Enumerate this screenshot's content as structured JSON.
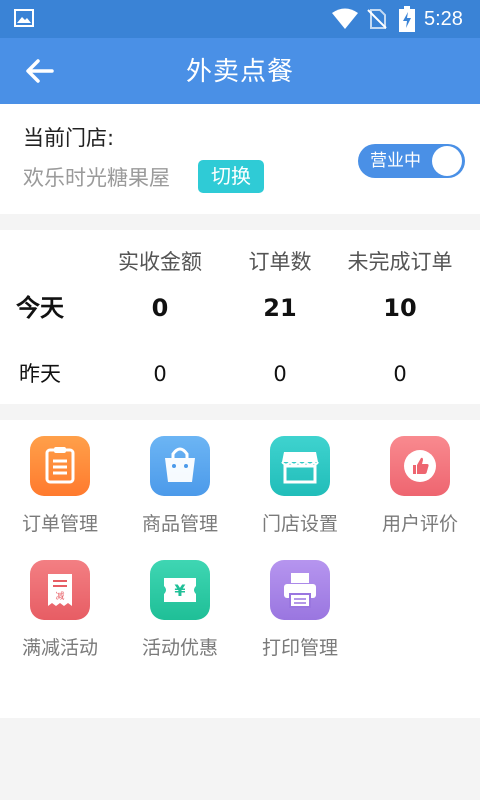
{
  "status_bar": {
    "time": "5:28"
  },
  "app_bar": {
    "title": "外卖点餐"
  },
  "store": {
    "label": "当前门店:",
    "name": "欢乐时光糖果屋",
    "switch_label": "切换",
    "status_toggle_label": "营业中"
  },
  "stats": {
    "headers": [
      "实收金额",
      "订单数",
      "未完成订单"
    ],
    "rows": [
      {
        "label": "今天",
        "values": [
          "0",
          "21",
          "10"
        ]
      },
      {
        "label": "昨天",
        "values": [
          "0",
          "0",
          "0"
        ]
      }
    ]
  },
  "menu": {
    "items": [
      {
        "label": "订单管理",
        "icon": "clipboard-icon",
        "color": "#ff8a3d"
      },
      {
        "label": "商品管理",
        "icon": "shopping-bag-icon",
        "color": "#5aa9ef"
      },
      {
        "label": "门店设置",
        "icon": "storefront-icon",
        "color": "#2ec8c6"
      },
      {
        "label": "用户评价",
        "icon": "thumbs-up-icon",
        "color": "#f2707a"
      },
      {
        "label": "满减活动",
        "icon": "discount-receipt-icon",
        "color": "#ee6a70"
      },
      {
        "label": "活动优惠",
        "icon": "coupon-yen-icon",
        "color": "#2fc9a6"
      },
      {
        "label": "打印管理",
        "icon": "printer-icon",
        "color": "#a784e6"
      }
    ]
  }
}
